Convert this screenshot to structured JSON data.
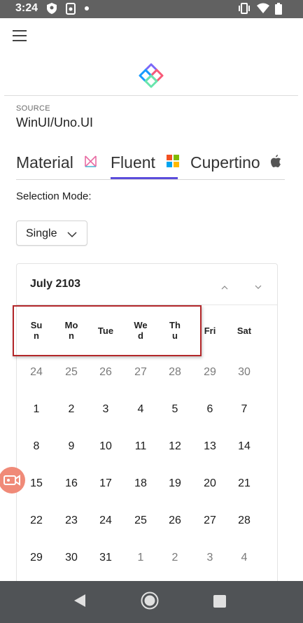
{
  "status_bar": {
    "time": "3:24",
    "icons": [
      "shield-icon",
      "screen-record-icon",
      "vibrate-icon",
      "wifi-icon",
      "battery-icon"
    ]
  },
  "header": {
    "menu_icon": "hamburger-menu-icon",
    "logo_icon": "uno-logo-icon"
  },
  "source": {
    "label": "SOURCE",
    "value": "WinUI/Uno.UI"
  },
  "tabs": [
    {
      "label": "Material",
      "icon": "material-icon",
      "selected": false
    },
    {
      "label": "Fluent",
      "icon": "windows-icon",
      "selected": true
    },
    {
      "label": "Cupertino",
      "icon": "apple-icon",
      "selected": false
    }
  ],
  "selection_mode": {
    "label": "Selection Mode:",
    "value": "Single"
  },
  "calendar": {
    "title": "July 2103",
    "days_of_week": [
      "Su\nn",
      "Mo\nn",
      "Tue",
      "We\nd",
      "Th\nu",
      "Fri",
      "Sat"
    ],
    "weeks": [
      [
        "24",
        "25",
        "26",
        "27",
        "28",
        "29",
        "30"
      ],
      [
        "1",
        "2",
        "3",
        "4",
        "5",
        "6",
        "7"
      ],
      [
        "8",
        "9",
        "10",
        "11",
        "12",
        "13",
        "14"
      ],
      [
        "15",
        "16",
        "17",
        "18",
        "19",
        "20",
        "21"
      ],
      [
        "22",
        "23",
        "24",
        "25",
        "26",
        "27",
        "28"
      ],
      [
        "29",
        "30",
        "31",
        "1",
        "2",
        "3",
        "4"
      ]
    ],
    "dim_color": "#7a7a7a",
    "text_color": "#1b1b1b"
  },
  "colors": {
    "accent": "#5b4cdb",
    "highlight_border": "#b3272a",
    "status_bar": "#616161",
    "nav_bar": "#505356"
  }
}
